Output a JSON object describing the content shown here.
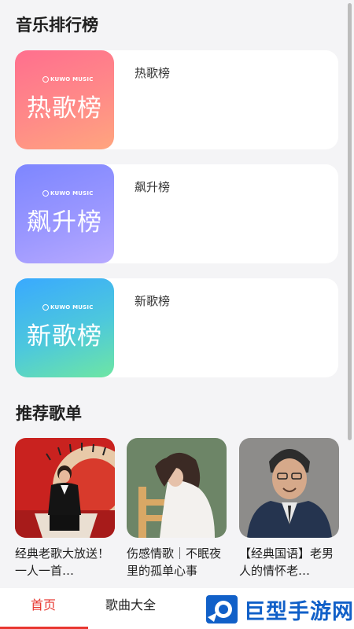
{
  "sections": {
    "charts_title": "音乐排行榜",
    "playlists_title": "推荐歌单"
  },
  "charts": [
    {
      "name": "热歌榜",
      "cover_text": "热歌榜",
      "brand": "KUWO MUSIC",
      "gradient": [
        "#ff6f8e",
        "#ffa57e"
      ]
    },
    {
      "name": "飙升榜",
      "cover_text": "飙升榜",
      "brand": "KUWO MUSIC",
      "gradient": [
        "#7d86ff",
        "#b7a9ff"
      ]
    },
    {
      "name": "新歌榜",
      "cover_text": "新歌榜",
      "brand": "KUWO MUSIC",
      "gradient": [
        "#39a9ff",
        "#6ee6a3"
      ]
    }
  ],
  "playlists": [
    {
      "caption": "经典老歌大放送！一人一首…"
    },
    {
      "caption": "伤感情歌｜不眠夜里的孤单心事"
    },
    {
      "caption": "【经典国语】老男人的情怀老…"
    }
  ],
  "tabbar": {
    "tabs": [
      "首页",
      "歌曲大全"
    ],
    "active_index": 0,
    "active_color": "#e8362f"
  },
  "watermark": {
    "text": "巨型手游网",
    "color": "#1160c8"
  }
}
